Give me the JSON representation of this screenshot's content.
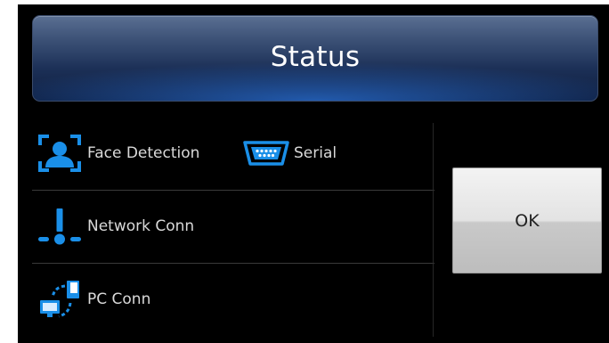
{
  "header": {
    "title": "Status"
  },
  "status_items": [
    {
      "label": "Face Detection",
      "icon": "face-detection-icon"
    },
    {
      "label": "Serial",
      "icon": "serial-port-icon"
    },
    {
      "label": "Network Conn",
      "icon": "network-icon"
    },
    {
      "label": "PC Conn",
      "icon": "pc-connection-icon"
    }
  ],
  "buttons": {
    "ok_label": "OK"
  },
  "colors": {
    "icon_blue": "#1a8fe8",
    "header_blue": "#1c3057",
    "background": "#000000",
    "label_text": "#d9d9d9"
  }
}
